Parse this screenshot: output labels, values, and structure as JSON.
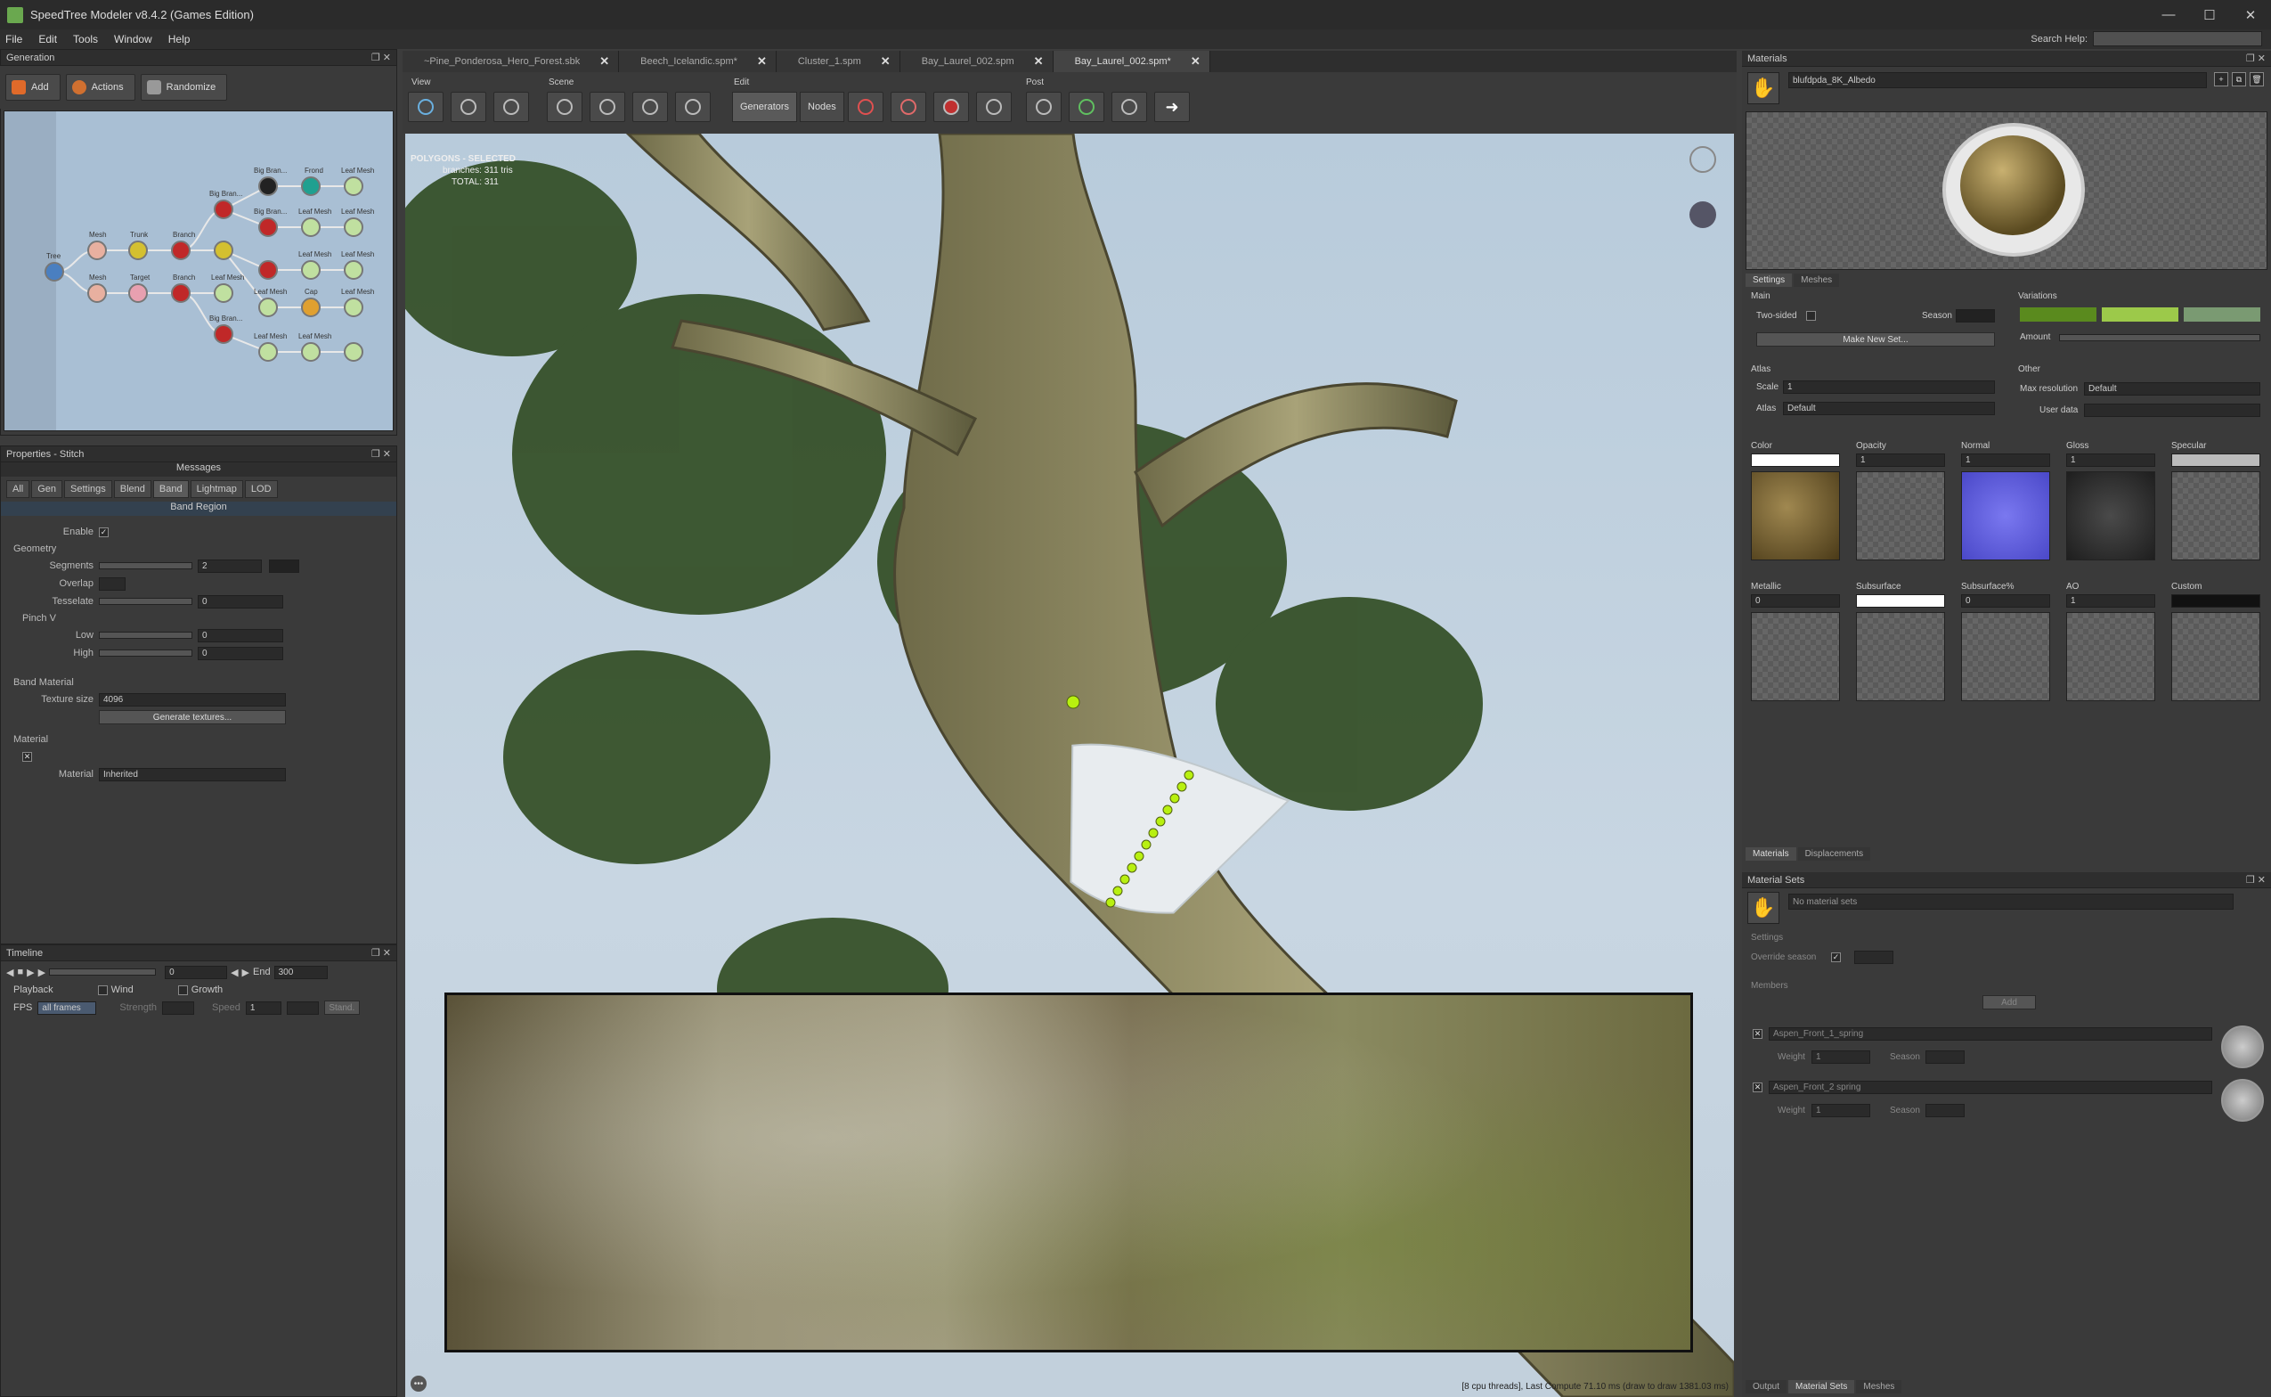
{
  "window": {
    "title": "SpeedTree Modeler v8.4.2 (Games Edition)",
    "minimize": "—",
    "maximize": "☐",
    "close": "✕"
  },
  "menu": [
    "File",
    "Edit",
    "Tools",
    "Window",
    "Help"
  ],
  "search_help_label": "Search Help:",
  "generation": {
    "title": "Generation",
    "buttons": [
      "Add",
      "Actions",
      "Randomize"
    ],
    "node_labels": [
      "Tree",
      "Mesh",
      "Mesh",
      "Trunk",
      "Target",
      "Branch",
      "Branch",
      "Big Bran...",
      "Big Bran...",
      "Big Bran...",
      "Big Bran...",
      "Frond",
      "Leaf Mesh",
      "Leaf Mesh",
      "Leaf Mesh",
      "Leaf Mesh",
      "Leaf Mesh",
      "Leaf Mesh",
      "Leaf Mesh",
      "Cap",
      "Leaf Mesh",
      "Leaf Mesh",
      "Leaf Mesh"
    ]
  },
  "properties": {
    "title": "Properties - Stitch",
    "messages": "Messages",
    "tabs": [
      "All",
      "Gen",
      "Settings",
      "Blend",
      "Band",
      "Lightmap",
      "LOD"
    ],
    "active_tab": "Band",
    "section": "Band Region",
    "enable_label": "Enable",
    "geometry_title": "Geometry",
    "segments_label": "Segments",
    "segments_value": "2",
    "overlap_label": "Overlap",
    "tesselate_label": "Tesselate",
    "tesselate_value": "0",
    "pinch_title": "Pinch V",
    "low_label": "Low",
    "low_value": "0",
    "high_label": "High",
    "high_value": "0",
    "band_material_title": "Band Material",
    "texture_size_label": "Texture size",
    "texture_size_value": "4096",
    "generate_button": "Generate textures...",
    "material_title": "Material",
    "material_label": "Material",
    "material_value": "Inherited"
  },
  "timeline": {
    "title": "Timeline",
    "value": "0",
    "end_label": "End",
    "end_value": "300",
    "playback_label": "Playback",
    "fps_label": "FPS",
    "fps_value": "all frames",
    "wind_label": "Wind",
    "strength_label": "Strength",
    "growth_label": "Growth",
    "speed_label": "Speed",
    "speed_value": "1",
    "std_label": "Stand."
  },
  "doc_tabs": [
    {
      "label": "~Pine_Ponderosa_Hero_Forest.sbk",
      "active": false
    },
    {
      "label": "Beech_Icelandic.spm*",
      "active": false
    },
    {
      "label": "Cluster_1.spm",
      "active": false
    },
    {
      "label": "Bay_Laurel_002.spm",
      "active": false
    },
    {
      "label": "Bay_Laurel_002.spm*",
      "active": true
    }
  ],
  "toolbar_groups": [
    "View",
    "Scene",
    "Edit",
    "Post"
  ],
  "edit_buttons": [
    "Generators",
    "Nodes"
  ],
  "viewport": {
    "overlay_title": "POLYGONS - SELECTED",
    "branches_line": "branches: 311 tris",
    "total_line": "TOTAL: 311",
    "status": "[8 cpu threads], Last Compute 71.10 ms (draw to draw 1381.03 ms)"
  },
  "materials": {
    "title": "Materials",
    "selected": "blufdpda_8K_Albedo",
    "tabs": [
      "Settings",
      "Meshes"
    ],
    "main_title": "Main",
    "two_sided_label": "Two-sided",
    "season_label": "Season",
    "make_new_set": "Make New Set...",
    "variations_title": "Variations",
    "amount_label": "Amount",
    "variation_colors": [
      "#5a8a1e",
      "#9cc94a",
      "#7a9a72"
    ],
    "atlas_title": "Atlas",
    "scale_label": "Scale",
    "scale_value": "1",
    "atlas_label": "Atlas",
    "atlas_value": "Default",
    "other_title": "Other",
    "max_res_label": "Max resolution",
    "max_res_value": "Default",
    "user_data_label": "User data",
    "slots_row1": [
      {
        "label": "Color",
        "value": ""
      },
      {
        "label": "Opacity",
        "value": "1"
      },
      {
        "label": "Normal",
        "value": "1"
      },
      {
        "label": "Gloss",
        "value": "1"
      },
      {
        "label": "Specular",
        "value": ""
      }
    ],
    "slots_row2": [
      {
        "label": "Metallic",
        "value": "0"
      },
      {
        "label": "Subsurface",
        "value": ""
      },
      {
        "label": "Subsurface%",
        "value": "0"
      },
      {
        "label": "AO",
        "value": "1"
      },
      {
        "label": "Custom",
        "value": ""
      }
    ],
    "bottom_tabs": [
      "Materials",
      "Displacements"
    ]
  },
  "material_sets": {
    "title": "Material Sets",
    "selected": "No material sets",
    "settings_title": "Settings",
    "override_label": "Override season",
    "members_title": "Members",
    "add_button": "Add",
    "members": [
      {
        "name": "Aspen_Front_1_spring",
        "weight_label": "Weight",
        "weight": "1",
        "season_label": "Season"
      },
      {
        "name": "Aspen_Front_2 spring",
        "weight_label": "Weight",
        "weight": "1",
        "season_label": "Season"
      }
    ],
    "bottom_tabs": [
      "Output",
      "Material Sets",
      "Meshes"
    ]
  }
}
